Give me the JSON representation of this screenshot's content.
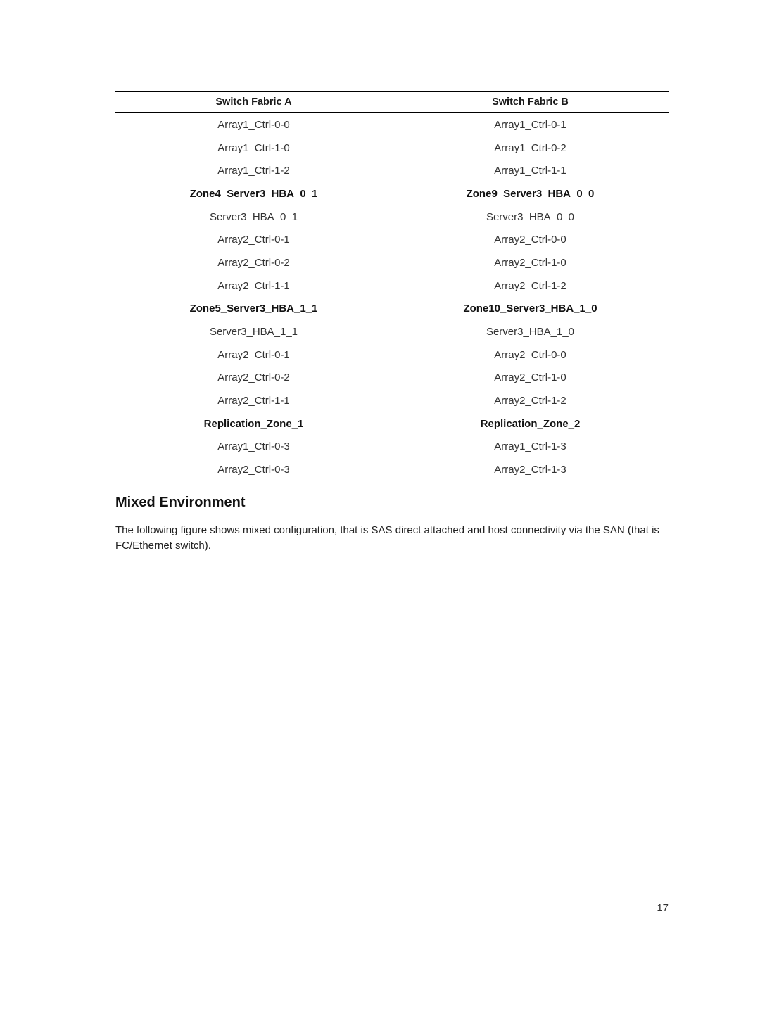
{
  "table": {
    "headers": [
      "Switch Fabric A",
      "Switch Fabric B"
    ],
    "rows": [
      {
        "a": "Array1_Ctrl-0-0",
        "b": "Array1_Ctrl-0-1",
        "zone": false
      },
      {
        "a": "Array1_Ctrl-1-0",
        "b": "Array1_Ctrl-0-2",
        "zone": false
      },
      {
        "a": "Array1_Ctrl-1-2",
        "b": "Array1_Ctrl-1-1",
        "zone": false
      },
      {
        "a": "Zone4_Server3_HBA_0_1",
        "b": "Zone9_Server3_HBA_0_0",
        "zone": true
      },
      {
        "a": "Server3_HBA_0_1",
        "b": "Server3_HBA_0_0",
        "zone": false
      },
      {
        "a": "Array2_Ctrl-0-1",
        "b": "Array2_Ctrl-0-0",
        "zone": false
      },
      {
        "a": "Array2_Ctrl-0-2",
        "b": "Array2_Ctrl-1-0",
        "zone": false
      },
      {
        "a": "Array2_Ctrl-1-1",
        "b": "Array2_Ctrl-1-2",
        "zone": false
      },
      {
        "a": "Zone5_Server3_HBA_1_1",
        "b": "Zone10_Server3_HBA_1_0",
        "zone": true
      },
      {
        "a": "Server3_HBA_1_1",
        "b": "Server3_HBA_1_0",
        "zone": false
      },
      {
        "a": "Array2_Ctrl-0-1",
        "b": "Array2_Ctrl-0-0",
        "zone": false
      },
      {
        "a": "Array2_Ctrl-0-2",
        "b": "Array2_Ctrl-1-0",
        "zone": false
      },
      {
        "a": "Array2_Ctrl-1-1",
        "b": "Array2_Ctrl-1-2",
        "zone": false
      },
      {
        "a": "Replication_Zone_1",
        "b": "Replication_Zone_2",
        "zone": true
      },
      {
        "a": "Array1_Ctrl-0-3",
        "b": "Array1_Ctrl-1-3",
        "zone": false
      },
      {
        "a": "Array2_Ctrl-0-3",
        "b": "Array2_Ctrl-1-3",
        "zone": false
      }
    ]
  },
  "section": {
    "title": "Mixed Environment",
    "paragraph": "The following figure shows mixed configuration, that is SAS direct attached and host connectivity via the SAN (that is FC/Ethernet switch)."
  },
  "page_number": "17"
}
